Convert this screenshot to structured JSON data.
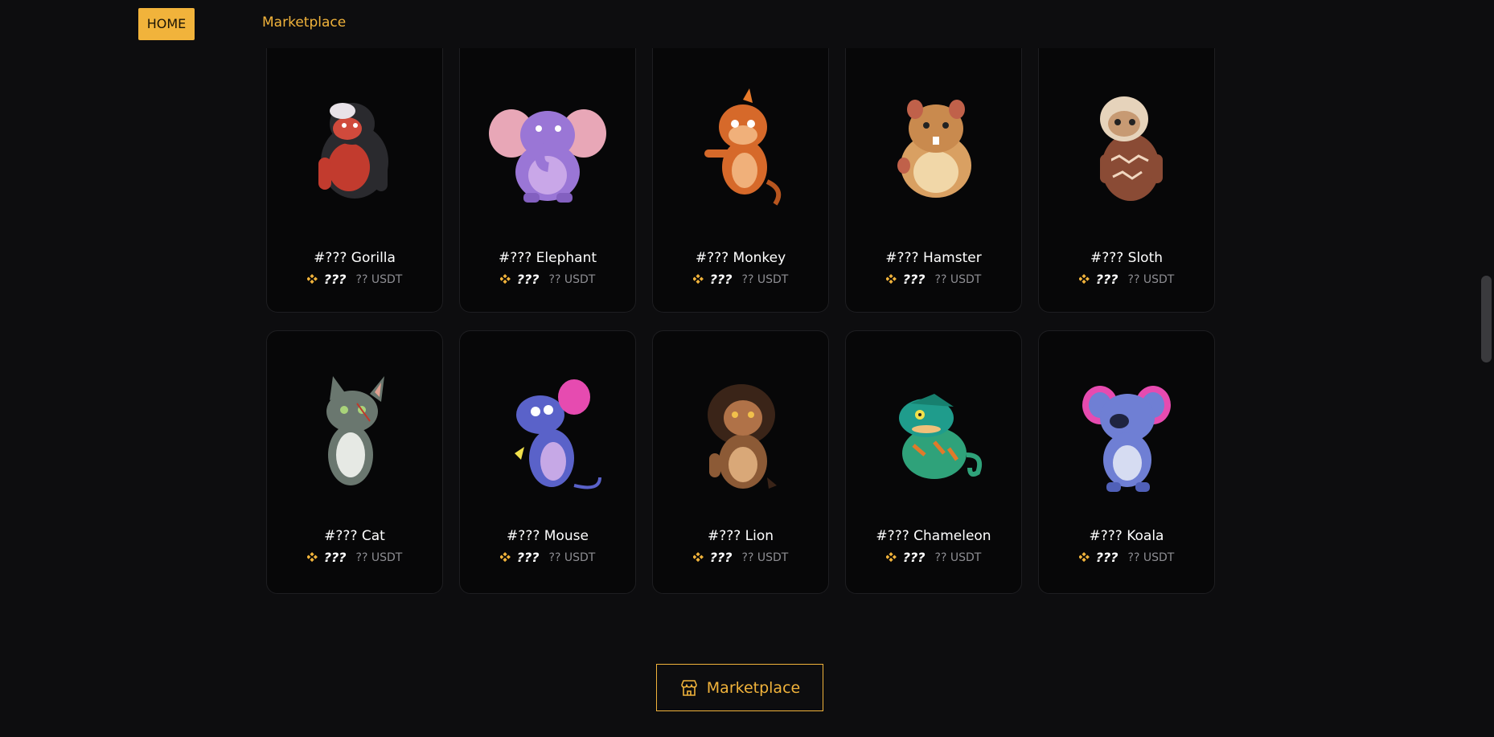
{
  "nav": {
    "home_label": "HOME",
    "marketplace_label": "Marketplace"
  },
  "cards": [
    {
      "name": "#??? Gorilla",
      "price": "???",
      "usd": "?? USDT",
      "icon": "gorilla-icon",
      "color": "#c23b2e"
    },
    {
      "name": "#??? Elephant",
      "price": "???",
      "usd": "?? USDT",
      "icon": "elephant-icon",
      "color": "#9a76d6"
    },
    {
      "name": "#??? Monkey",
      "price": "???",
      "usd": "?? USDT",
      "icon": "monkey-icon",
      "color": "#d6692a"
    },
    {
      "name": "#??? Hamster",
      "price": "???",
      "usd": "?? USDT",
      "icon": "hamster-icon",
      "color": "#d9a062"
    },
    {
      "name": "#??? Sloth",
      "price": "???",
      "usd": "?? USDT",
      "icon": "sloth-icon",
      "color": "#8a4b35"
    },
    {
      "name": "#??? Cat",
      "price": "???",
      "usd": "?? USDT",
      "icon": "cat-icon",
      "color": "#7d8a82"
    },
    {
      "name": "#??? Mouse",
      "price": "???",
      "usd": "?? USDT",
      "icon": "mouse-icon",
      "color": "#5a62c9"
    },
    {
      "name": "#??? Lion",
      "price": "???",
      "usd": "?? USDT",
      "icon": "lion-icon",
      "color": "#8c5a36"
    },
    {
      "name": "#??? Chameleon",
      "price": "???",
      "usd": "?? USDT",
      "icon": "chameleon-icon",
      "color": "#2fa27a"
    },
    {
      "name": "#??? Koala",
      "price": "???",
      "usd": "?? USDT",
      "icon": "koala-icon",
      "color": "#6f7fd4"
    }
  ],
  "marketplace_button": {
    "label": "Marketplace",
    "icon": "shop-icon"
  },
  "colors": {
    "accent": "#f1b33b",
    "background": "#0d0d0f",
    "card": "#070708"
  }
}
